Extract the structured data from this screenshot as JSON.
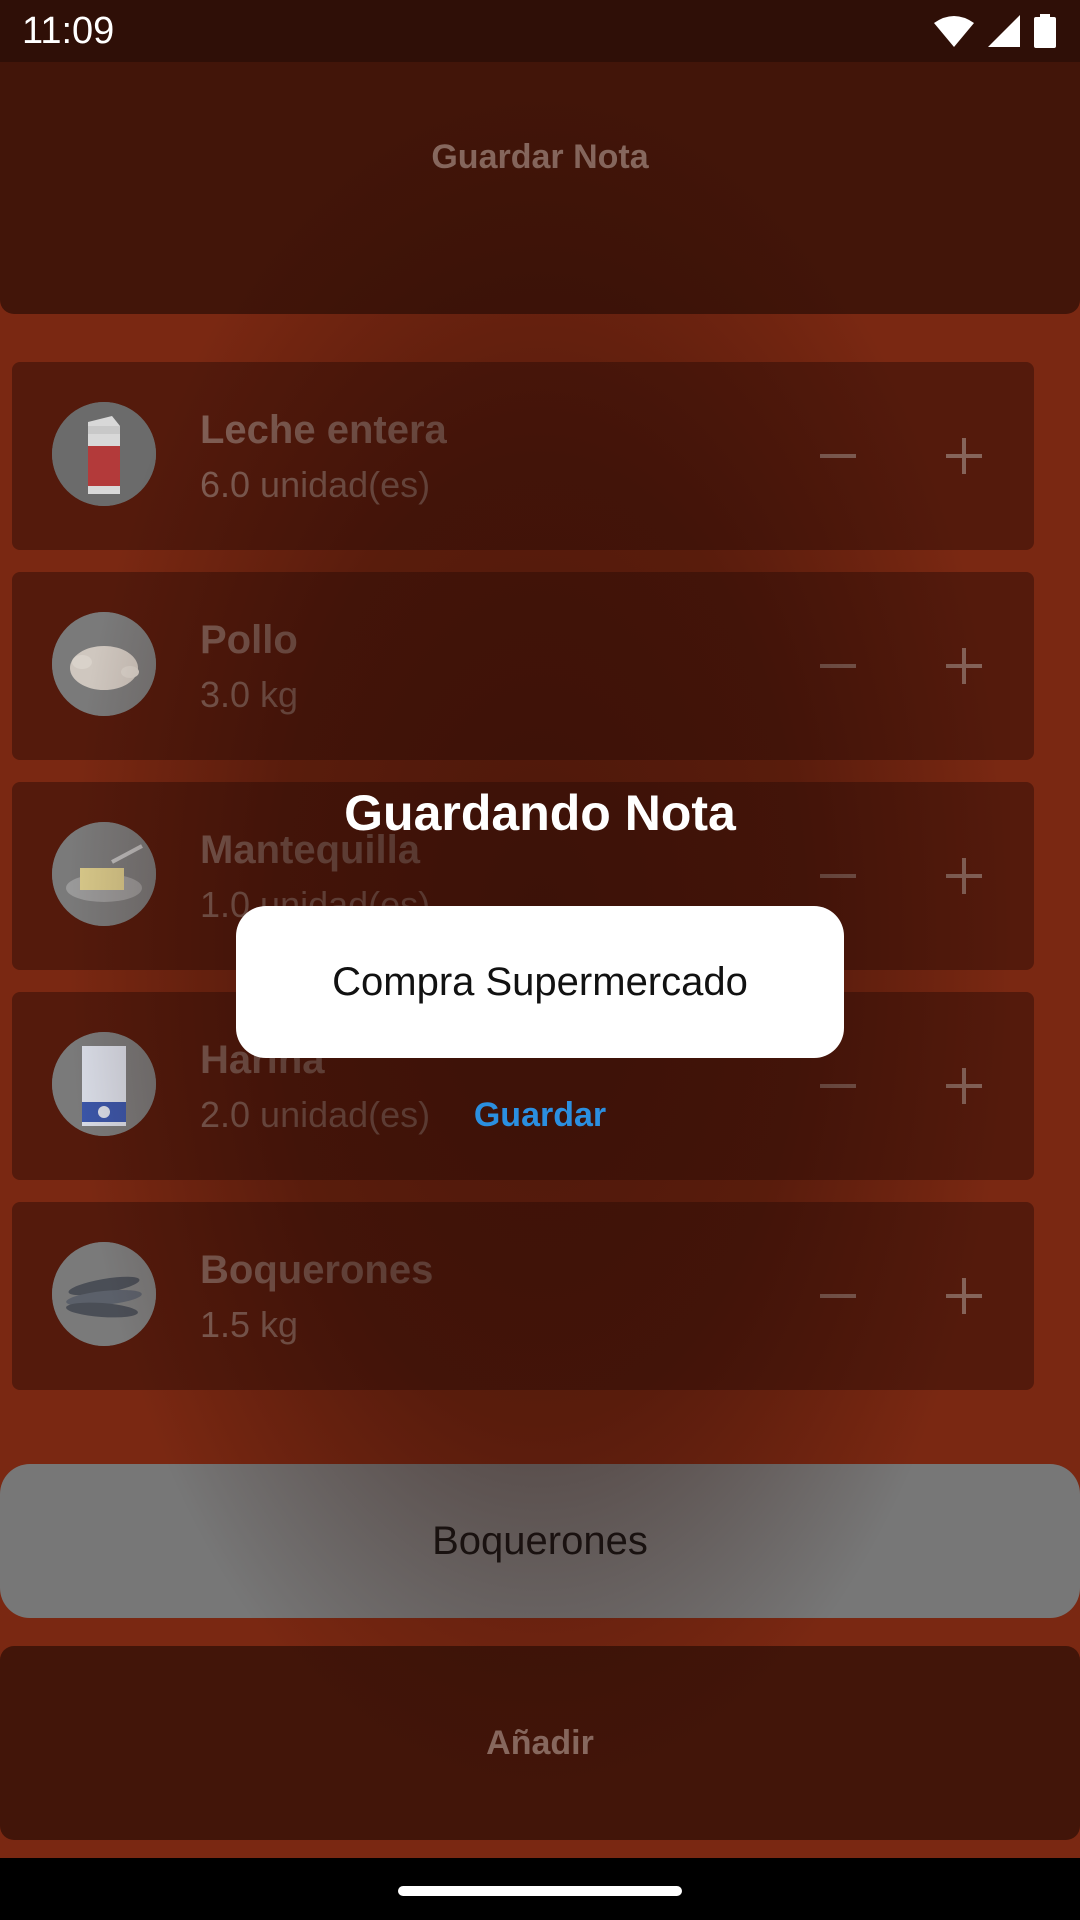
{
  "status": {
    "time": "11:09"
  },
  "header": {
    "save_note_label": "Guardar Nota"
  },
  "items": [
    {
      "name": "Leche entera",
      "quantity": "6.0 unidad(es)",
      "icon": "milk-carton-icon"
    },
    {
      "name": "Pollo",
      "quantity": "3.0 kg",
      "icon": "chicken-icon"
    },
    {
      "name": "Mantequilla",
      "quantity": "1.0 unidad(es)",
      "icon": "butter-icon"
    },
    {
      "name": "Harina",
      "quantity": "2.0 unidad(es)",
      "icon": "flour-bag-icon"
    },
    {
      "name": "Boquerones",
      "quantity": "1.5 kg",
      "icon": "fish-icon"
    }
  ],
  "input": {
    "value": "Boquerones"
  },
  "footer": {
    "add_label": "Añadir"
  },
  "dialog": {
    "title": "Guardando Nota",
    "field_value": "Compra Supermercado",
    "action_label": "Guardar"
  },
  "colors": {
    "background": "#7a2812",
    "bar": "#421509",
    "card": "#541a0c",
    "accent": "#2b8fe0"
  }
}
